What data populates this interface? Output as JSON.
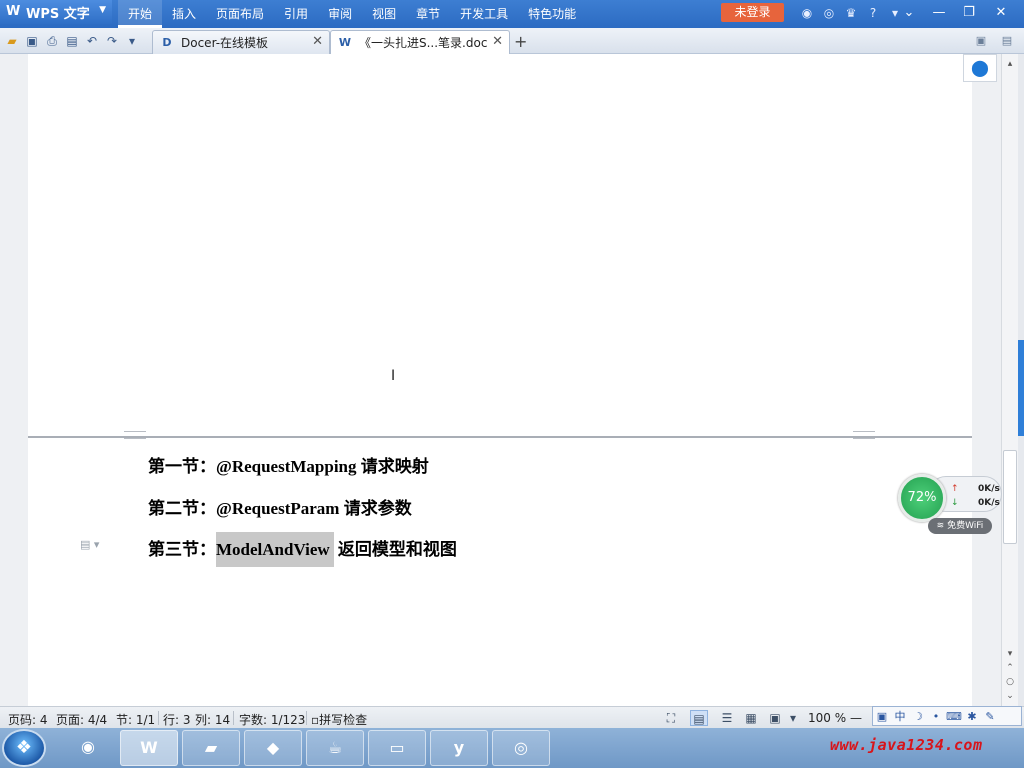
{
  "app": {
    "name": "WPS 文字",
    "logo_glyph": "W"
  },
  "menu": {
    "items": [
      {
        "label": "开始",
        "active": true
      },
      {
        "label": "插入"
      },
      {
        "label": "页面布局"
      },
      {
        "label": "引用"
      },
      {
        "label": "审阅"
      },
      {
        "label": "视图"
      },
      {
        "label": "章节"
      },
      {
        "label": "开发工具"
      },
      {
        "label": "特色功能"
      }
    ],
    "login_label": "未登录"
  },
  "tabs": [
    {
      "label": "Docer-在线模板",
      "icon": "docer-icon",
      "active": false
    },
    {
      "label": "《一头扎进S...笔录.doc",
      "icon": "word-doc-icon",
      "active": true
    }
  ],
  "document": {
    "headings": [
      {
        "prefix": "第一节：",
        "term": "@RequestMapping",
        "suffix": " 请求映射"
      },
      {
        "prefix": "第二节：",
        "term": "@RequestParam",
        "suffix": " 请求参数"
      },
      {
        "prefix": "第三节：",
        "term": "ModelAndView",
        "suffix": " 返回模型和视图"
      }
    ]
  },
  "network": {
    "percent": "72%",
    "upload": "0K/s",
    "download": "0K/s",
    "wifi_label": "免费WiFi"
  },
  "status": {
    "page_code": "页码: 4",
    "pages": "页面: 4/4",
    "section": "节: 1/1",
    "row": "行: 3",
    "col": "列: 14",
    "words": "字数: 1/123",
    "spell": "拼写检查",
    "zoom": "100 %"
  },
  "ime": {
    "lang": "中"
  },
  "watermark": "www.java1234.com",
  "colors": {
    "titlebar": "#2c6bc2",
    "login": "#e7643c",
    "highlight": "#c8c8c8",
    "net_green": "#23a050",
    "side_accent": "#2f7fd8"
  }
}
